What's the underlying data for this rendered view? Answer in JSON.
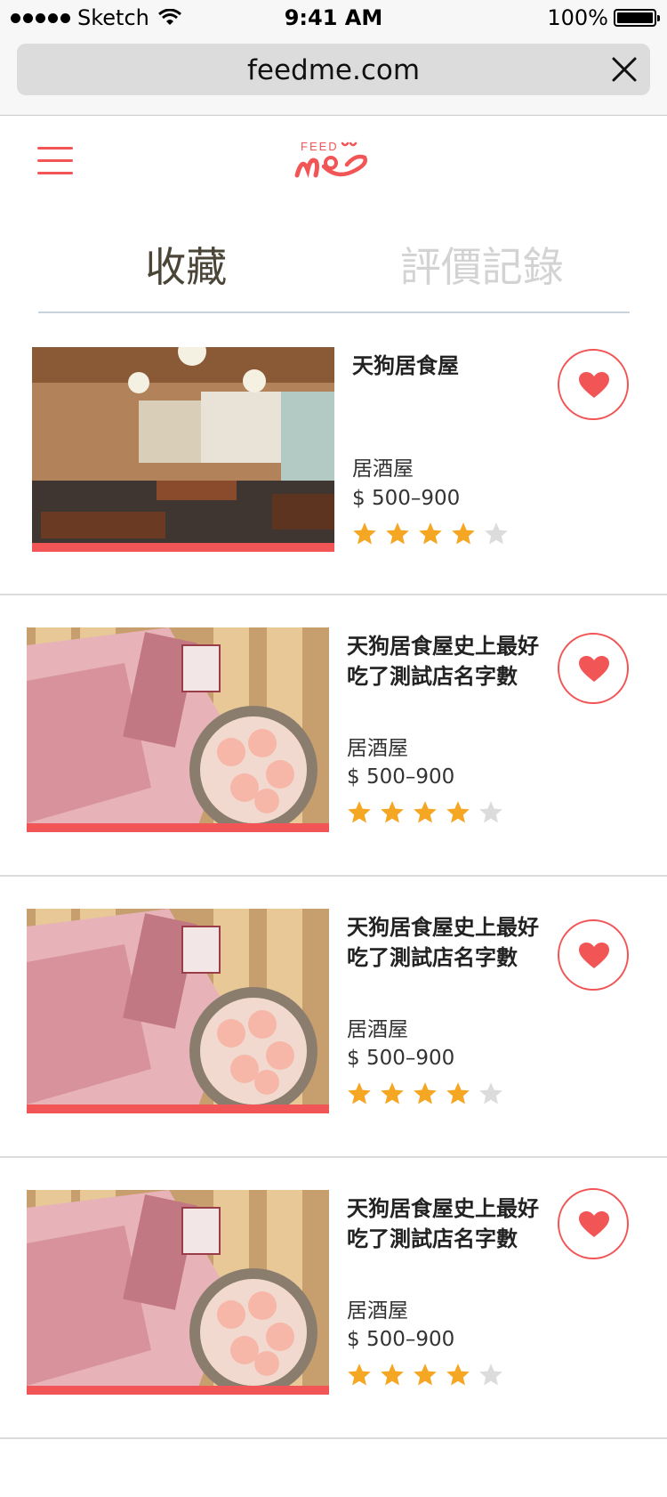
{
  "status_bar": {
    "carrier": "Sketch",
    "time": "9:41 AM",
    "battery": "100%"
  },
  "browser": {
    "url": "feedme.com"
  },
  "header": {
    "logo_text": "FEED"
  },
  "tabs": [
    {
      "label": "收藏",
      "active": true
    },
    {
      "label": "評價記錄",
      "active": false
    }
  ],
  "restaurants": [
    {
      "name": "天狗居食屋",
      "category": "居酒屋",
      "price": "$ 500–900",
      "rating": 4,
      "max_rating": 5,
      "favorited": true
    },
    {
      "name": "天狗居食屋史上最好吃了測試店名字數",
      "category": "居酒屋",
      "price": "$ 500–900",
      "rating": 4,
      "max_rating": 5,
      "favorited": true
    },
    {
      "name": "天狗居食屋史上最好吃了測試店名字數",
      "category": "居酒屋",
      "price": "$ 500–900",
      "rating": 4,
      "max_rating": 5,
      "favorited": true
    },
    {
      "name": "天狗居食屋史上最好吃了測試店名字數",
      "category": "居酒屋",
      "price": "$ 500–900",
      "rating": 4,
      "max_rating": 5,
      "favorited": true
    }
  ],
  "colors": {
    "accent": "#f25555",
    "star_filled": "#f5a623",
    "star_empty": "#dcdcdc",
    "tab_active": "#4a4536",
    "tab_inactive": "#d3d3d3"
  }
}
